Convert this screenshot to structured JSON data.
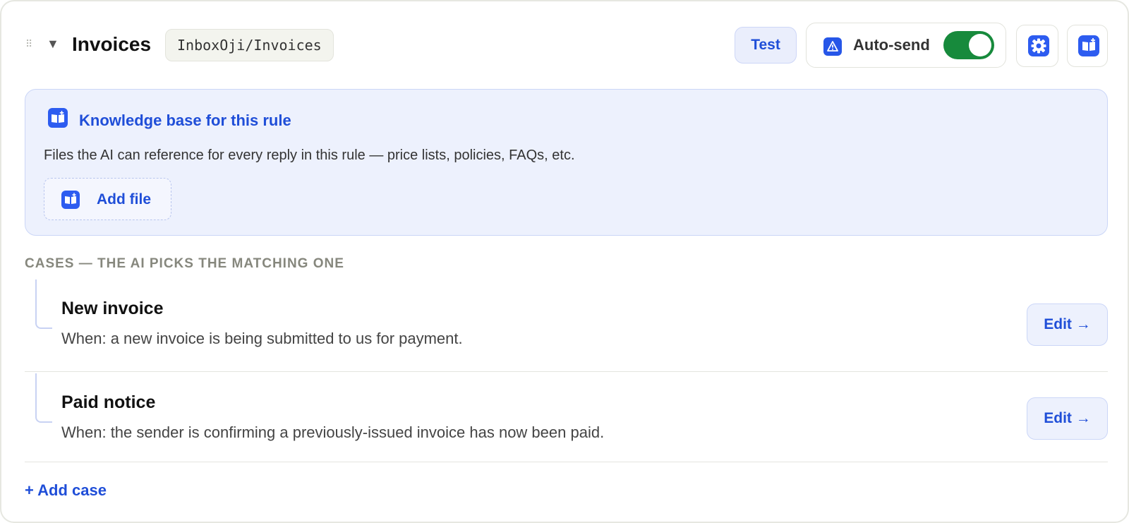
{
  "header": {
    "title": "Invoices",
    "path": "InboxOji/Invoices",
    "drag_glyph": "⠿",
    "caret_glyph": "▼",
    "test_label": "Test",
    "autosend_label": "Auto-send",
    "autosend_enabled": true
  },
  "icons": {
    "warning": "warning-icon",
    "gear": "gear-icon",
    "book": "book-icon"
  },
  "knowledge_base": {
    "title": "Knowledge base for this rule",
    "description": "Files the AI can reference for every reply in this rule — price lists, policies, FAQs, etc.",
    "add_file_label": "Add file"
  },
  "cases": {
    "heading": "CASES — THE AI PICKS THE MATCHING ONE",
    "items": [
      {
        "title": "New invoice",
        "description": "When: a new invoice is being submitted to us for payment.",
        "edit_label": "Edit →"
      },
      {
        "title": "Paid notice",
        "description": "When: the sender is confirming a previously-issued invoice has now been paid.",
        "edit_label": "Edit →"
      }
    ],
    "add_case_label": "+ Add case"
  },
  "colors": {
    "accent": "#1f4ed8",
    "toggle_on": "#178a3c",
    "kb_background": "#edf1fd"
  }
}
